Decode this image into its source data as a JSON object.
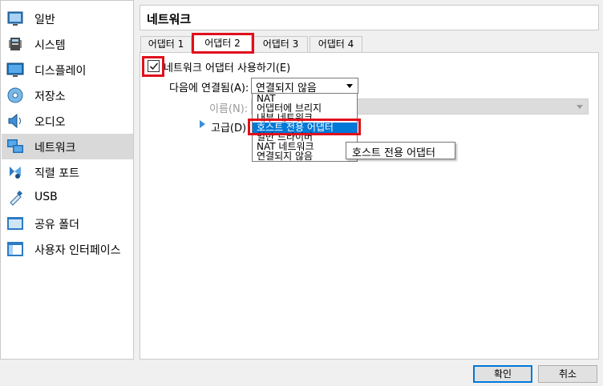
{
  "sidebar": {
    "items": [
      {
        "label": "일반",
        "icon": "general-icon"
      },
      {
        "label": "시스템",
        "icon": "system-icon"
      },
      {
        "label": "디스플레이",
        "icon": "display-icon"
      },
      {
        "label": "저장소",
        "icon": "storage-icon"
      },
      {
        "label": "오디오",
        "icon": "audio-icon"
      },
      {
        "label": "네트워크",
        "icon": "network-icon",
        "selected": true
      },
      {
        "label": "직렬 포트",
        "icon": "serial-port-icon"
      },
      {
        "label": "USB",
        "icon": "usb-icon"
      },
      {
        "label": "공유 폴더",
        "icon": "shared-folder-icon"
      },
      {
        "label": "사용자 인터페이스",
        "icon": "user-interface-icon"
      }
    ]
  },
  "header": {
    "title": "네트워크"
  },
  "tabs": [
    {
      "label": "어댑터 1"
    },
    {
      "label": "어댑터 2",
      "active": true
    },
    {
      "label": "어댑터 3"
    },
    {
      "label": "어댑터 4"
    }
  ],
  "form": {
    "enable_label": "네트워크 어댑터 사용하기(E)",
    "enabled": true,
    "attached_label": "다음에 연결됨(A):",
    "attached_value": "연결되지 않음",
    "name_label": "이름(N):",
    "advanced_label": "고급(D)"
  },
  "dropdown": {
    "options": [
      "NAT",
      "어댑터에 브리지",
      "내부 네트워크",
      "호스트 전용 어댑터",
      "일반 드라이버",
      "NAT 네트워크",
      "연결되지 않음"
    ],
    "highlighted_index": 3
  },
  "tooltip": {
    "text": "호스트 전용 어댑터"
  },
  "buttons": {
    "ok": "확인",
    "cancel": "취소"
  },
  "colors": {
    "highlight": "#e0101c",
    "selection": "#0078d7",
    "accent": "#3b8fd9"
  }
}
